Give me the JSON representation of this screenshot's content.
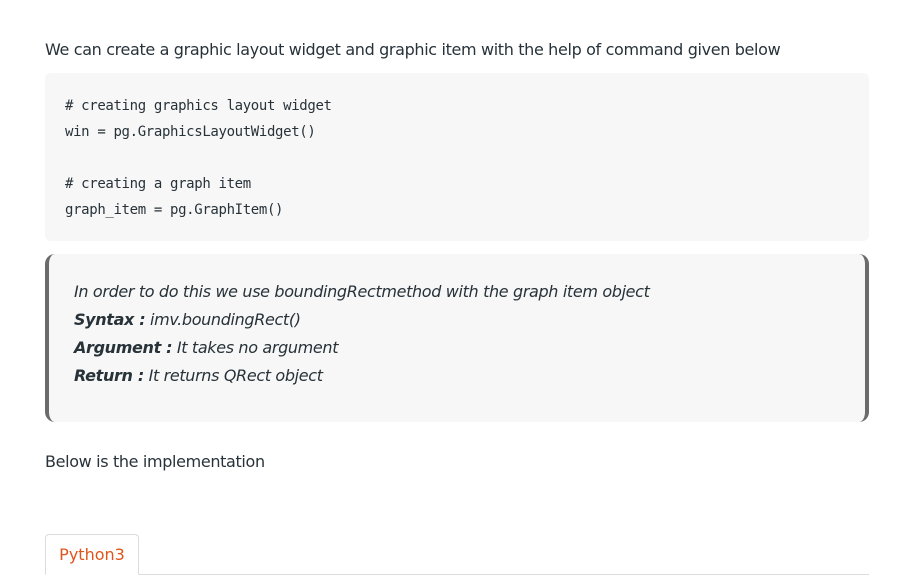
{
  "intro_text": "We can create a graphic layout widget and graphic item with the help of command given below",
  "code": {
    "lines": [
      "# creating graphics layout widget",
      "win = pg.GraphicsLayoutWidget()",
      "",
      "# creating a graph item",
      "graph_item = pg.GraphItem()"
    ]
  },
  "quote": {
    "description": "In order to do this we use boundingRectmethod with the graph item object",
    "syntax_label": "Syntax :",
    "syntax_value": " imv.boundingRect()",
    "argument_label": "Argument :",
    "argument_value": " It takes no argument",
    "return_label": "Return :",
    "return_value": " It returns QRect object"
  },
  "below_text": "Below is the implementation",
  "tabs": [
    {
      "label": "Python3",
      "active": true
    }
  ],
  "colors": {
    "accent": "#e0551b",
    "text": "#273239",
    "code_bg": "#f7f7f7",
    "quote_border": "#6b6b6b"
  }
}
